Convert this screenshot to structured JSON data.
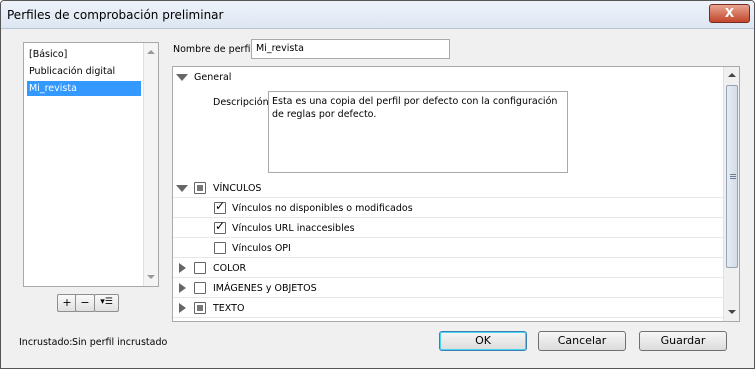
{
  "window": {
    "title": "Perfiles de comprobación preliminar",
    "close_glyph": "X"
  },
  "profiles": {
    "items": [
      "[Básico]",
      "Publicación digital",
      "Mi_revista"
    ],
    "selected_index": 2,
    "buttons": {
      "add_glyph": "+",
      "remove_glyph": "−",
      "menu_glyph": "▾☰"
    }
  },
  "profile_name": {
    "label": "Nombre de perfil:",
    "value": "Mi_revista"
  },
  "general": {
    "header": "General",
    "description_label": "Descripción:",
    "description": "Esta es una copia del perfil por defecto con la configuración de reglas por defecto."
  },
  "sections": {
    "vinculos": {
      "label": "VÍNCULOS",
      "items": [
        {
          "label": "Vínculos no disponibles o modificados",
          "checked": true
        },
        {
          "label": "Vínculos URL inaccesibles",
          "checked": true
        },
        {
          "label": "Vínculos OPI",
          "checked": false
        }
      ]
    },
    "color": {
      "label": "COLOR"
    },
    "imagenes": {
      "label": "IMÁGENES y OBJETOS"
    },
    "texto": {
      "label": "TEXTO"
    }
  },
  "status": {
    "label": "Incrustado:",
    "value": "Sin perfil incrustado"
  },
  "buttons": {
    "ok": "OK",
    "cancel": "Cancelar",
    "save": "Guardar"
  },
  "colors": {
    "selection": "#3399ff",
    "default_button_border": "#3c7fb1"
  }
}
